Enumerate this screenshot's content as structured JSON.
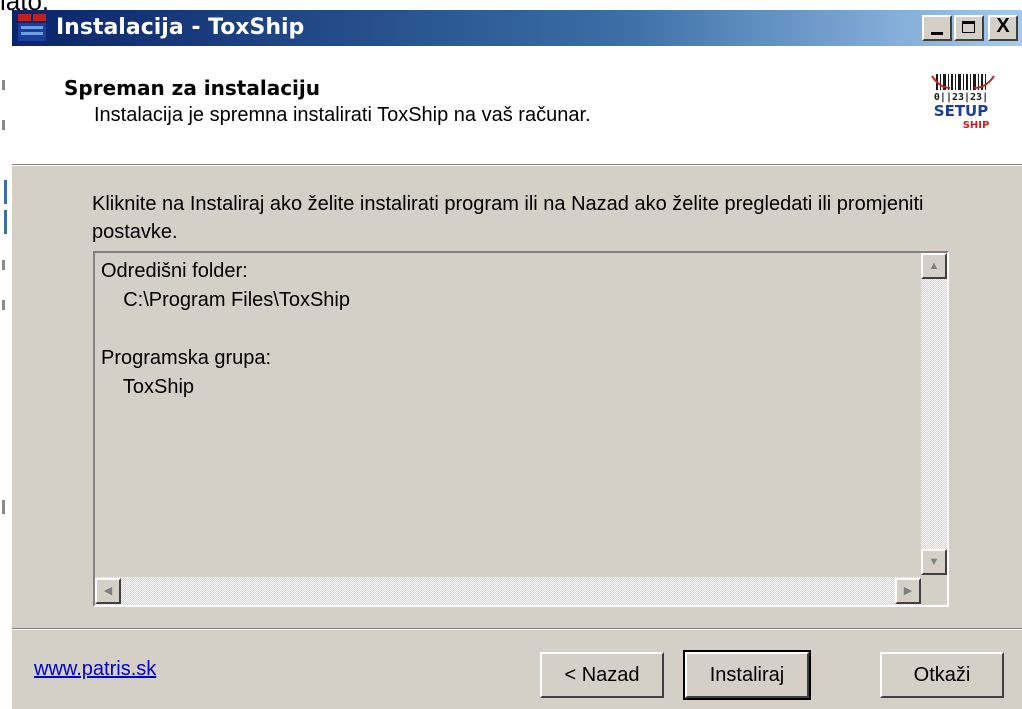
{
  "background_fragment": "lato.",
  "window": {
    "title": "Instalacija - ToxShip",
    "controls": {
      "minimize": "_",
      "maximize": "□",
      "close": "X"
    }
  },
  "header": {
    "title": "Spreman za instalaciju",
    "subtitle": "Instalacija je spremna instalirati ToxShip na vaš računar.",
    "logo": {
      "line1": "0||23|23|",
      "line2": "SETUP",
      "line3": "SHIP",
      "accent": "#1a3e9e",
      "red": "#cc1f1f"
    }
  },
  "body": {
    "instruction": "Kliknite na Instaliraj ako želite instalirati program ili na Nazad ako želite pregledati ili promjeniti postavke."
  },
  "summary": {
    "destination_label": "Odredišni folder:",
    "destination_value": "C:\\Program Files\\ToxShip",
    "group_label": "Programska grupa:",
    "group_value": "ToxShip"
  },
  "footer": {
    "link": "www.patris.sk",
    "back_label": "< Nazad",
    "install_label": "Instaliraj",
    "cancel_label": "Otkaži"
  },
  "colors": {
    "titlebar_start": "#0a246a",
    "titlebar_end": "#a6caf0",
    "dialog_face": "#d4d0c8",
    "link": "#0000cc"
  }
}
